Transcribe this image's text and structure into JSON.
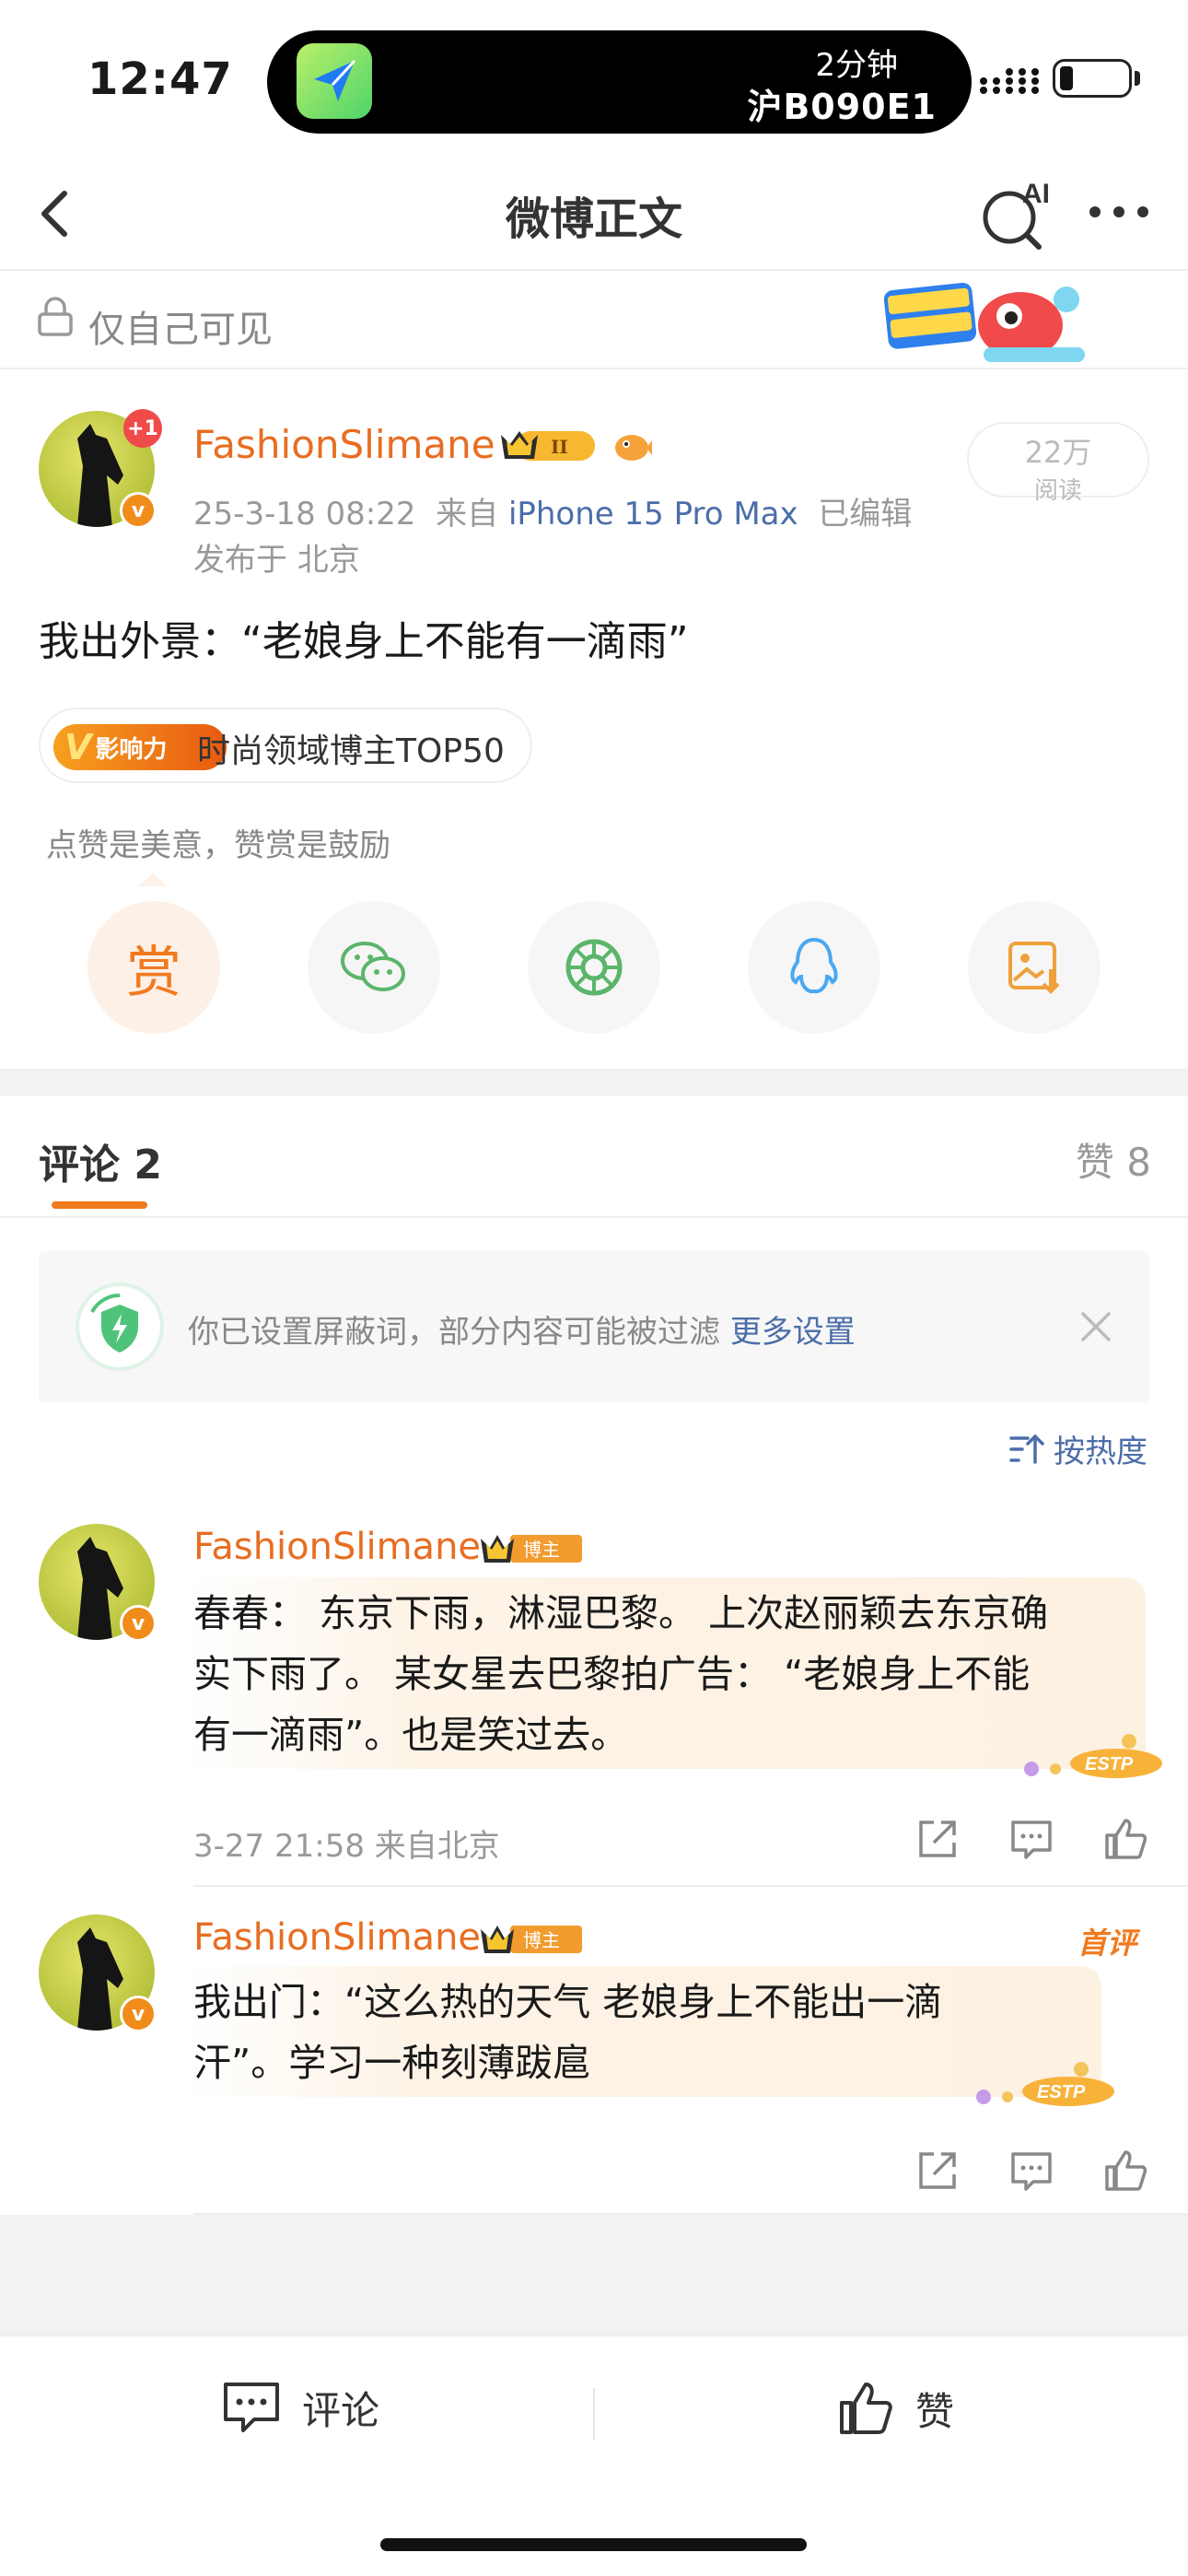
{
  "status": {
    "time": "12:47",
    "island_line1": "2分钟",
    "island_line2": "沪B090E1"
  },
  "nav": {
    "title": "微博正文"
  },
  "privacy": {
    "label": "仅自己可见"
  },
  "post": {
    "username": "FashionSlimane",
    "plus_badge": "+1",
    "rank_badge": "II",
    "datetime": "25-3-18 08:22",
    "source_prefix": "来自",
    "device": "iPhone 15 Pro Max",
    "edited": "已编辑",
    "location": "发布于 北京",
    "read_count": "22万",
    "read_label": "阅读",
    "text": "我出外景：“老娘身上不能有一滴雨”",
    "influence_tag": "影响力",
    "influence_text": "时尚领域博主TOP50"
  },
  "tip": "点赞是美意，赞赏是鼓励",
  "share": {
    "reward_label": "赏"
  },
  "tabs": {
    "comments": "评论 2",
    "likes": "赞 8"
  },
  "filter": {
    "text": "你已设置屏蔽词，部分内容可能被过滤",
    "link": "更多设置"
  },
  "sort": {
    "label": "按热度"
  },
  "comments": [
    {
      "username": "FashionSlimane",
      "badge": "博主",
      "lines": [
        "春春： 东京下雨，淋湿巴黎。 上次赵丽颖去东京确",
        "实下雨了。 某女星去巴黎拍广告： “老娘身上不能",
        "有一滴雨”。也是笑过去。"
      ],
      "meta": "3-27 21:58 来自北京",
      "estp": "ESTP"
    },
    {
      "username": "FashionSlimane",
      "badge": "博主",
      "tag": "首评",
      "lines": [
        "我出门：“这么热的天气 老娘身上不能出一滴",
        "汗”。学习一种刻薄跋扈"
      ],
      "estp": "ESTP"
    }
  ],
  "bottom": {
    "comment": "评论",
    "like": "赞"
  },
  "colors": {
    "accent": "#f07a1e",
    "username": "#e86d22",
    "link": "#4b6ea8"
  }
}
